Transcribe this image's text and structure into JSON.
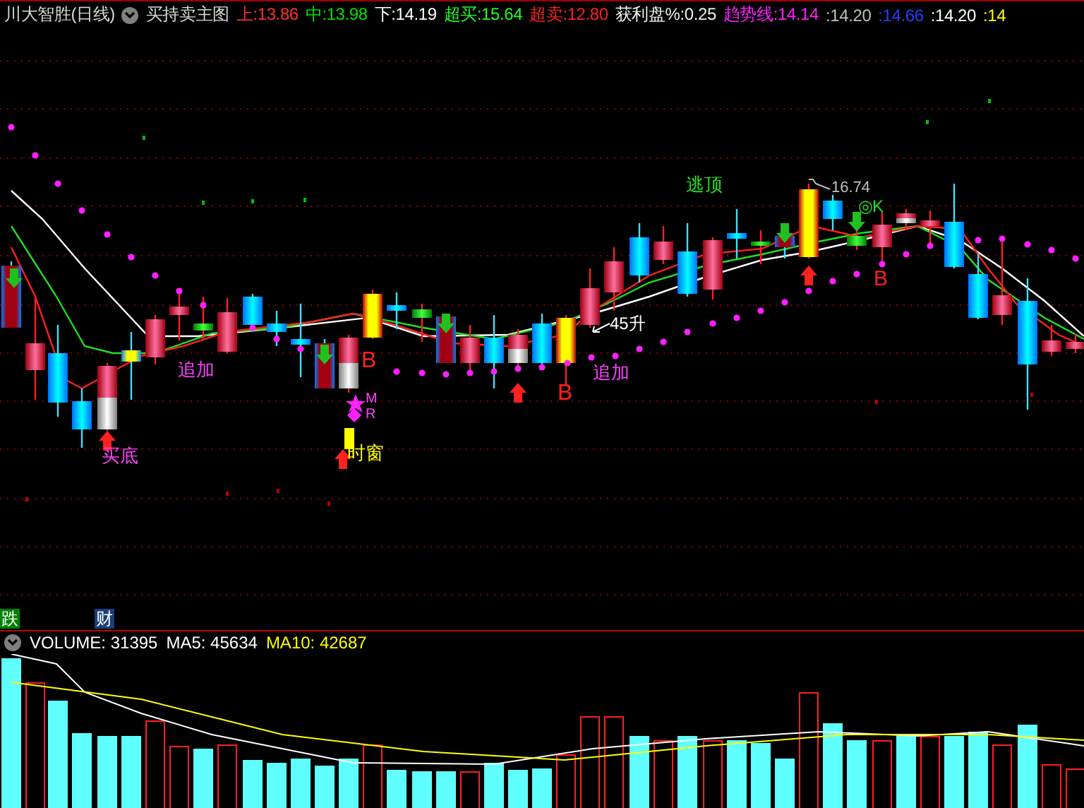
{
  "header": {
    "title": "川大智胜(日线)",
    "indicator": "买持卖主图",
    "values": [
      {
        "text": "上:13.86",
        "color": "#ff3030"
      },
      {
        "text": "中:13.98",
        "color": "#00e000"
      },
      {
        "text": "下:14.19",
        "color": "#ffffff"
      },
      {
        "text": "超买:15.64",
        "color": "#20ff20"
      },
      {
        "text": "超卖:12.80",
        "color": "#ff2020"
      },
      {
        "text": "获利盘%:0.25",
        "color": "#f0f0f0"
      },
      {
        "text": "趋势线:14.14",
        "color": "#ff20ff"
      },
      {
        "text": ":14.20",
        "color": "#c0c0c0"
      },
      {
        "text": ":14.66",
        "color": "#2040ff"
      },
      {
        "text": ":14.20",
        "color": "#ffffff"
      },
      {
        "text": ":14",
        "color": "#ffff00"
      }
    ]
  },
  "chart": {
    "annotations": [
      {
        "text": "逃顶",
        "color": "#20e020"
      },
      {
        "text": "16.74",
        "color": "#c0c0c0"
      },
      {
        "text": "◎K",
        "color": "#20e020"
      },
      {
        "text": "B",
        "color": "#ff2020"
      },
      {
        "text": "45升",
        "color": "#ffffff"
      },
      {
        "text": "追加",
        "color": "#ff40ff"
      },
      {
        "text": "B",
        "color": "#ff2020"
      },
      {
        "text": "追加",
        "color": "#ff40ff"
      },
      {
        "text": "B",
        "color": "#ff2020"
      },
      {
        "text": "M",
        "color": "#ff40ff"
      },
      {
        "text": "R",
        "color": "#ff40ff"
      },
      {
        "text": "时窗",
        "color": "#ffff00"
      },
      {
        "text": "买底",
        "color": "#ff40ff"
      }
    ],
    "tags": [
      {
        "text": "跌",
        "color": "#008000"
      },
      {
        "text": "财",
        "color": "#1a3f7a"
      }
    ]
  },
  "volume": {
    "values": [
      {
        "text": "VOLUME: 31395",
        "color": "#ffffff"
      },
      {
        "text": "MA5: 45634",
        "color": "#ffffff"
      },
      {
        "text": "MA10: 42687",
        "color": "#ffff00"
      }
    ]
  }
}
